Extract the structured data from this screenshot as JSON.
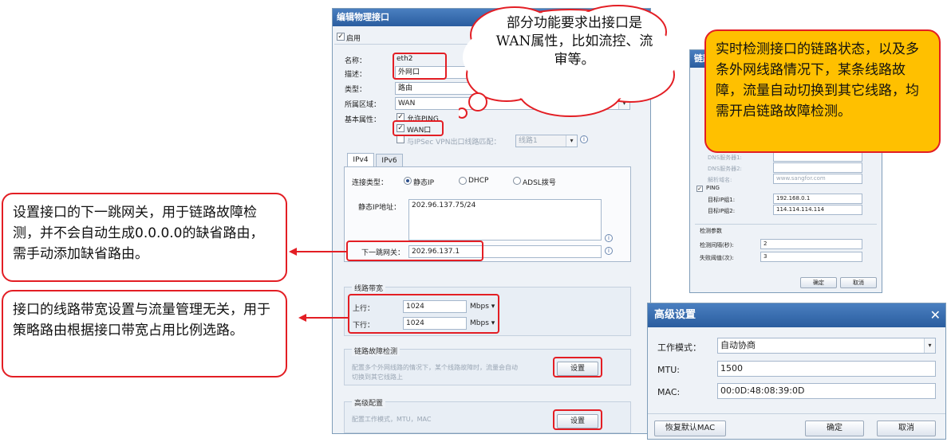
{
  "dialog": {
    "title": "编辑物理接口",
    "enable_label": "启用",
    "name_label": "名称：",
    "name_value": "eth2",
    "desc_label": "描述：",
    "desc_value": "外网口",
    "type_label": "类型：",
    "type_value": "路由",
    "zone_label": "所属区域：",
    "zone_value": "WAN",
    "basic_label": "基本属性：",
    "allow_ping": "允许PING",
    "wan_port": "WAN口",
    "ipsec_label": "与IPSec VPN出口线路匹配：",
    "ipsec_value": "线路1",
    "tabs": [
      "IPv4",
      "IPv6"
    ],
    "conn_type_label": "连接类型：",
    "conn_types": [
      "静态IP",
      "DHCP",
      "ADSL拨号"
    ],
    "static_ip_label": "静态IP地址：",
    "static_ip_value": "202.96.137.75/24",
    "gateway_label": "下一跳网关：",
    "gateway_value": "202.96.137.1",
    "bandwidth_title": "线路带宽",
    "up_label": "上行：",
    "up_value": "1024",
    "down_label": "下行：",
    "down_value": "1024",
    "unit": "Mbps",
    "fault_title": "链路故障检测",
    "fault_desc_1": "配置多个外网线路的情况下，某个线路故障时，流量会自动",
    "fault_desc_2": "切换到其它线路上",
    "set_label": "设置",
    "adv_title": "高级配置",
    "adv_desc": "配置工作模式，MTU，MAC"
  },
  "cloud_note": "部分功能要求出接口是WAN属性，比如流控、流审等。",
  "callout_right": "实时检测接口的链路状态，以及多条外网线路情况下，某条线路故障，流量自动切换到其它线路，均需开启链路故障检测。",
  "callout_gateway": "设置接口的下一跳网关，用于链路故障检测，并不会自动生成0.0.0.0的缺省路由，需手动添加缺省路由。",
  "callout_bandwidth": "接口的线路带宽设置与流量管理无关，用于策略路由根据接口带宽占用比例选路。",
  "link_dialog": {
    "title": "链路",
    "dns1_label": "DNS服务器1:",
    "dns2_label": "DNS服务器2:",
    "domain_label": "解析域名:",
    "domain_value": "www.sangfor.com",
    "ping_label": "PING",
    "target1_label": "目标IP组1:",
    "target1_value": "192.168.0.1",
    "target2_label": "目标IP组2:",
    "target2_value": "114.114.114.114",
    "params_title": "检测参数",
    "interval_label": "检测间隔(秒):",
    "interval_value": "2",
    "threshold_label": "失败阈值(次):",
    "threshold_value": "3",
    "ok": "确定",
    "cancel": "取消"
  },
  "adv_dialog": {
    "title": "高级设置",
    "mode_label": "工作模式：",
    "mode_value": "自动协商",
    "mtu_label": "MTU:",
    "mtu_value": "1500",
    "mac_label": "MAC:",
    "mac_value": "00:0D:48:08:39:0D",
    "restore": "恢复默认MAC",
    "ok": "确定",
    "cancel": "取消"
  },
  "colors": {
    "accent": "#e31e24",
    "title": "#2a5d9f",
    "callout_fill": "#ffc000"
  }
}
